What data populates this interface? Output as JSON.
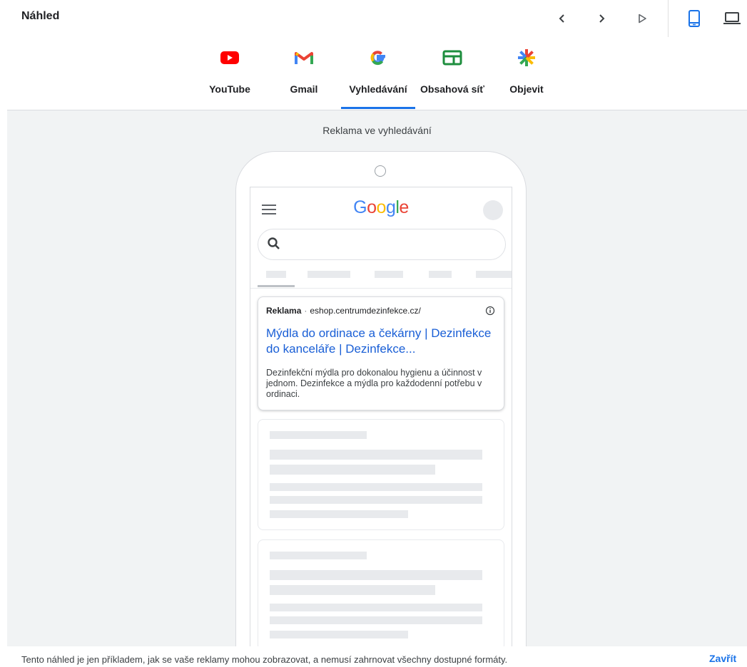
{
  "header": {
    "title": "Náhled",
    "prev_icon": "chevron-left-icon",
    "next_icon": "chevron-right-icon",
    "play_icon": "play-icon",
    "mobile_icon": "smartphone-icon",
    "desktop_icon": "laptop-icon",
    "selected_device": "mobile"
  },
  "tabs": [
    {
      "label": "YouTube",
      "icon": "youtube-icon"
    },
    {
      "label": "Gmail",
      "icon": "gmail-icon"
    },
    {
      "label": "Vyhledávání",
      "icon": "google-icon",
      "selected": true
    },
    {
      "label": "Obsahová síť",
      "icon": "display-network-icon"
    },
    {
      "label": "Objevit",
      "icon": "discover-icon"
    }
  ],
  "preview": {
    "caption": "Reklama ve vyhledávání",
    "google_logo": "Google",
    "ad": {
      "label": "Reklama",
      "separator": "·",
      "url": "eshop.centrumdezinfekce.cz/",
      "headline": "Mýdla do ordinace a čekárny | Dezinfekce do kanceláře | Dezinfekce...",
      "description": "Dezinfekční mýdla pro dokonalou hygienu a účinnost v jednom. Dezinfekce a mýdla pro každodenní potřebu v ordinaci."
    }
  },
  "footer": {
    "note": "Tento náhled je jen příkladem, jak se vaše reklamy mohou zobrazovat, a nemusí zahrnovat všechny dostupné formáty.",
    "close_label": "Zavřít"
  },
  "colors": {
    "accent": "#1a73e8",
    "youtube_red": "#ff0000",
    "ad_headline": "#1a5fd6",
    "preview_bg": "#f1f3f4"
  }
}
